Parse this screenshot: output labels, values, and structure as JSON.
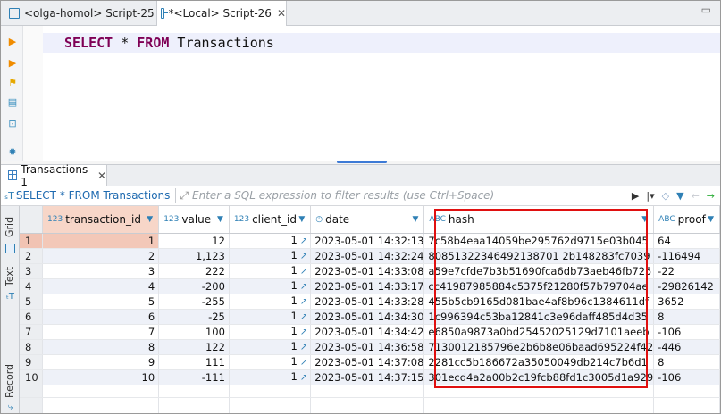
{
  "tabs": [
    {
      "label": "<olga-homol> Script-25",
      "active": false
    },
    {
      "label": "*<Local> Script-26",
      "active": true
    }
  ],
  "editor": {
    "kw1": "SELECT",
    "middle": " * ",
    "kw2": "FROM",
    "tail": " Transactions"
  },
  "results_tab": {
    "label": "Transactions 1"
  },
  "filter": {
    "query": "SELECT * FROM Transactions",
    "placeholder": "Enter a SQL expression to filter results (use Ctrl+Space)"
  },
  "side_labels": {
    "grid": "Grid",
    "text": "Text",
    "record": "Record"
  },
  "columns": [
    {
      "type": "123",
      "label": "transaction_id"
    },
    {
      "type": "123",
      "label": "value"
    },
    {
      "type": "123",
      "label": "client_id"
    },
    {
      "type": "clock",
      "label": "date"
    },
    {
      "type": "ABC",
      "label": "hash"
    },
    {
      "type": "ABC",
      "label": "proof"
    }
  ],
  "rows": [
    {
      "n": "1",
      "tid": "1",
      "value": "12",
      "cid": "1",
      "date": "2023-05-01 14:32:13",
      "hash": "7c58b4eaa14059be295762d9715e03b045",
      "proof": "64"
    },
    {
      "n": "2",
      "tid": "2",
      "value": "1,123",
      "cid": "1",
      "date": "2023-05-01 14:32:24",
      "hash": "80851322346492138701 2b148283fc7039",
      "proof": "-116494"
    },
    {
      "n": "3",
      "tid": "3",
      "value": "222",
      "cid": "1",
      "date": "2023-05-01 14:33:08",
      "hash": "a59e7cfde7b3b51690fca6db73aeb46fb725",
      "proof": "-22"
    },
    {
      "n": "4",
      "tid": "4",
      "value": "-200",
      "cid": "1",
      "date": "2023-05-01 14:33:17",
      "hash": "cc41987985884c5375f21280f57b79704ae",
      "proof": "-29826142"
    },
    {
      "n": "5",
      "tid": "5",
      "value": "-255",
      "cid": "1",
      "date": "2023-05-01 14:33:28",
      "hash": "455b5cb9165d081bae4af8b96c1384611df",
      "proof": "3652"
    },
    {
      "n": "6",
      "tid": "6",
      "value": "-25",
      "cid": "1",
      "date": "2023-05-01 14:34:30",
      "hash": "1c996394c53ba12841c3e96daff485d4d35",
      "proof": "8"
    },
    {
      "n": "7",
      "tid": "7",
      "value": "100",
      "cid": "1",
      "date": "2023-05-01 14:34:42",
      "hash": "e6850a9873a0bd25452025129d7101aeeb",
      "proof": "-106"
    },
    {
      "n": "8",
      "tid": "8",
      "value": "122",
      "cid": "1",
      "date": "2023-05-01 14:36:58",
      "hash": "7130012185796e2b6b8e06baad695224f42",
      "proof": "-446"
    },
    {
      "n": "9",
      "tid": "9",
      "value": "111",
      "cid": "1",
      "date": "2023-05-01 14:37:08",
      "hash": "2281cc5b186672a35050049db214c7b6d1",
      "proof": "8"
    },
    {
      "n": "10",
      "tid": "10",
      "value": "-111",
      "cid": "1",
      "date": "2023-05-01 14:37:15",
      "hash": "301ecd4a2a00b2c19fcb88fd1c3005d1a929",
      "proof": "-106"
    }
  ],
  "colors": {
    "highlight": "#e01010",
    "selected_row": "#f1c3b3",
    "keyword": "#7f0055"
  }
}
